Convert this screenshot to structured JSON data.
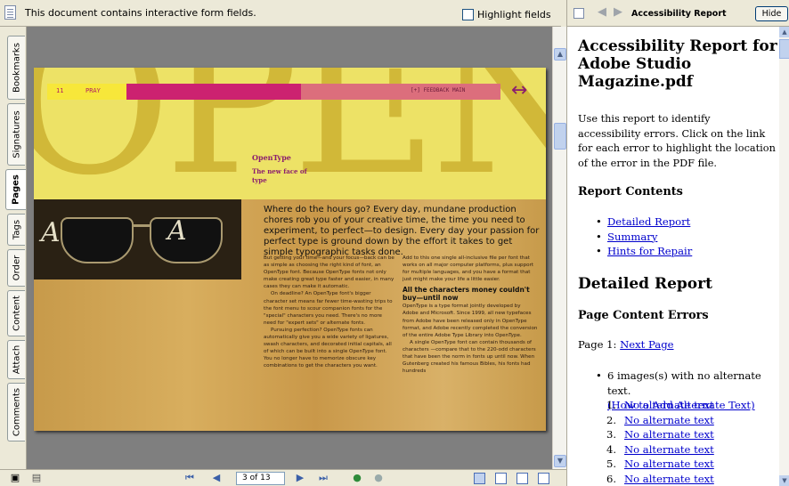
{
  "notice": {
    "message": "This document contains interactive form fields.",
    "highlight_label": "Highlight fields"
  },
  "tabs": [
    {
      "label": "Bookmarks"
    },
    {
      "label": "Signatures"
    },
    {
      "label": "Pages"
    },
    {
      "label": "Tags"
    },
    {
      "label": "Order"
    },
    {
      "label": "Content"
    },
    {
      "label": "Attach"
    },
    {
      "label": "Comments"
    }
  ],
  "page": {
    "big_word": "OPEN",
    "page_number": "11",
    "section": "PRAY",
    "nav_right": "[+] FEEDBACK  MAIN",
    "arrows": "↔",
    "heading": "OpenType",
    "subheading": "The new face of type",
    "letter_left": "A",
    "letter_right": "A",
    "lead": "Where do the hours go? Every day, mundane production chores rob you of your creative time, the time you need to experiment, to perfect—to design. Every day your passion for perfect type is ground down by the effort it takes to get simple typographic tasks done.",
    "col1_p1": "But getting your time—and your focus—back can be as simple as choosing the right kind of font, an OpenType font. Because OpenType fonts not only make creating great type faster and easier, in many cases they can make it automatic.",
    "col1_p2": "On deadline? An OpenType font's bigger character set means far fewer time-wasting trips to the font menu to scour companion fonts for the \"special\" characters you need. There's no more need for \"expert sets\" or alternate fonts.",
    "col1_p3": "Pursuing perfection? OpenType fonts can automatically give you a wide variety of ligatures, swash characters, and decorated initial capitals, all of which can be built into a single OpenType font. You no longer have to memorize obscure key combinations to get the characters you want.",
    "col2_p1": "Add to this one single all-inclusive file per font that works on all major computer platforms, plus support for multiple languages, and you have a format that just might make your life a little easier.",
    "col2_head": "All the characters money couldn't buy—until now",
    "col2_p2": "OpenType is a type format jointly developed by Adobe and Microsoft. Since 1999, all new typefaces from Adobe have been released only in OpenType format, and Adobe recently completed the conversion of the entire Adobe Type Library into OpenType.",
    "col2_p3": "A single OpenType font can contain thousands of characters —compare that to the 220-odd characters that have been the norm in fonts up until now. When Gutenberg created his famous Bibles, his fonts had hundreds"
  },
  "bottombar": {
    "page_field": "3 of 13"
  },
  "report_panel": {
    "title": "Accessibility Report",
    "hide_label": "Hide",
    "heading": "Accessibility Report for Adobe Studio Magazine.pdf",
    "intro": "Use this report to identify accessibility errors. Click on the link for each error to highlight the location of the error in the PDF file.",
    "contents_heading": "Report Contents",
    "contents_links": [
      "Detailed Report",
      "Summary",
      "Hints for Repair"
    ],
    "detailed_heading": "Detailed Report",
    "page_errors_heading": "Page Content Errors",
    "page_label": "Page 1:",
    "next_page_link": "Next Page",
    "images_text": "6 images(s) with no alternate text.",
    "how_to_link": "(How to Add Alternate Text)",
    "alt_items": [
      {
        "num": "1.",
        "label": "No alternate text"
      },
      {
        "num": "2.",
        "label": "No alternate text"
      },
      {
        "num": "3.",
        "label": "No alternate text"
      },
      {
        "num": "4.",
        "label": "No alternate text"
      },
      {
        "num": "5.",
        "label": "No alternate text"
      },
      {
        "num": "6.",
        "label": "No alternate text"
      }
    ]
  }
}
